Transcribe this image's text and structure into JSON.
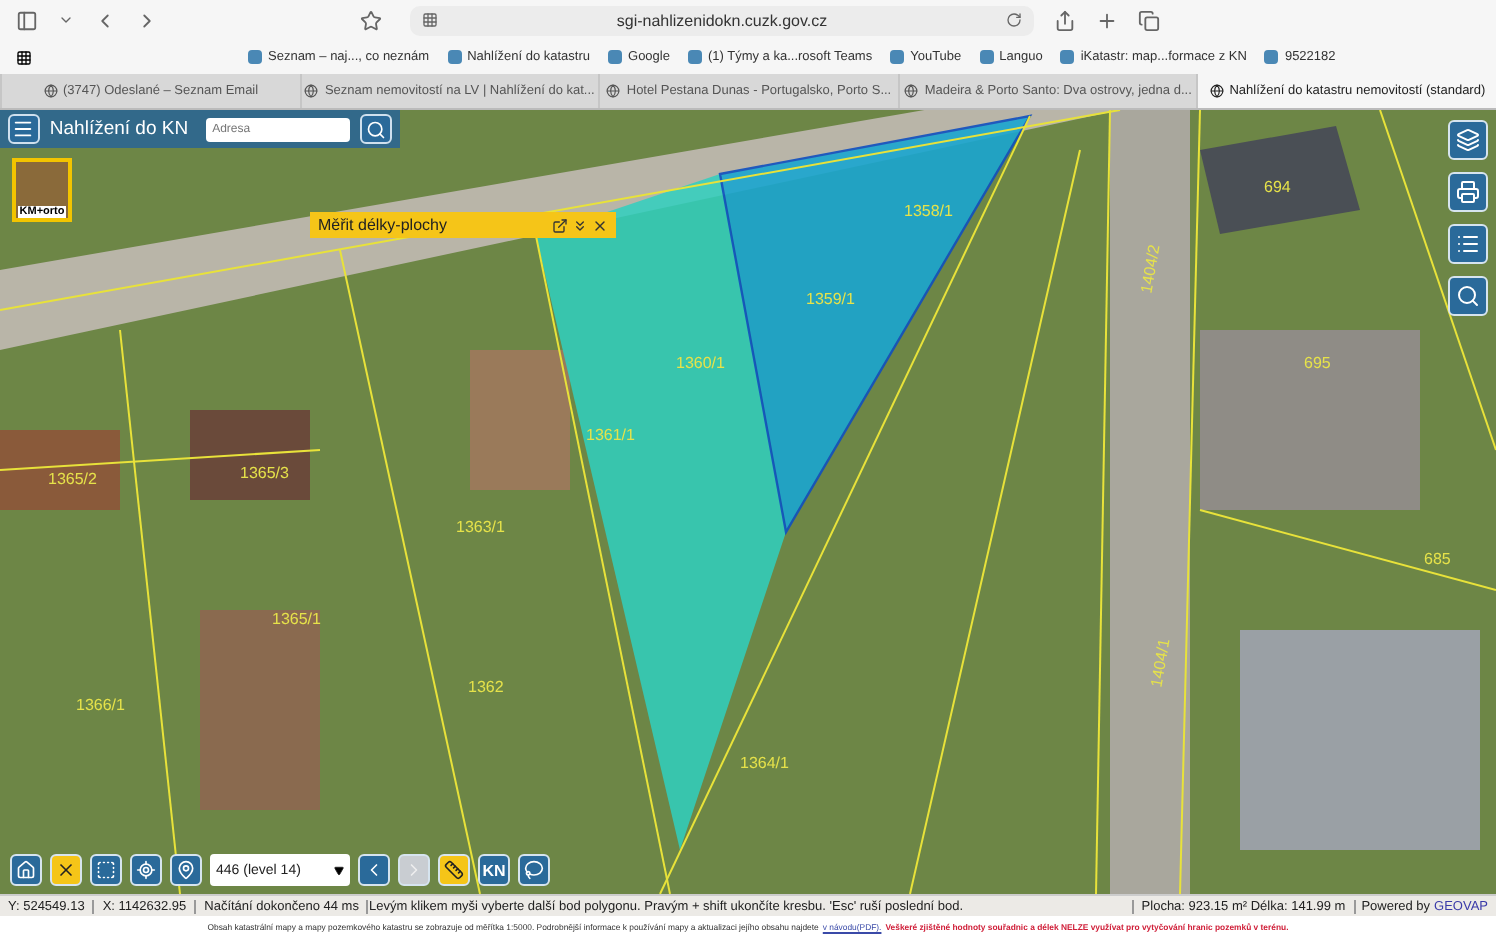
{
  "browser": {
    "url": "sgi-nahlizenidokn.cuzk.gov.cz",
    "bookmarks": [
      "Seznam – naj..., co neznám",
      "Nahlížení do katastru",
      "Google",
      "(1) Týmy a ka...rosoft Teams",
      "YouTube",
      "Languo",
      "iKatastr: map...formace z KN",
      "9522182"
    ],
    "tabs": [
      {
        "label": "(3747) Odeslané – Seznam Email",
        "selected": false
      },
      {
        "label": "Seznam nemovitostí na LV | Nahlížení do kat...",
        "selected": false
      },
      {
        "label": "Hotel Pestana Dunas - Portugalsko, Porto S...",
        "selected": false
      },
      {
        "label": "Madeira & Porto Santo: Dva ostrovy, jedna d...",
        "selected": false
      },
      {
        "label": "Nahlížení do katastru nemovitostí (standard)",
        "selected": true
      }
    ]
  },
  "map_header": {
    "title": "Nahlížení do KN",
    "search": {
      "placeholder": "Adresa"
    }
  },
  "basemap": {
    "label": "KM+orto"
  },
  "measure_panel": {
    "title": "Měřit délky-plochy"
  },
  "parcel_labels": [
    "1358/1",
    "1359/1",
    "1360/1",
    "1361/1",
    "1363/1",
    "1365/2",
    "1365/3",
    "1365/1",
    "1366/1",
    "1362",
    "1364/1",
    "1404/2",
    "1404/1",
    "694",
    "695",
    "685"
  ],
  "map_tools": [
    {
      "kind": "layers"
    },
    {
      "kind": "print"
    },
    {
      "kind": "legend"
    },
    {
      "kind": "search"
    }
  ],
  "toolbar": [
    {
      "kind": "home",
      "active": false
    },
    {
      "kind": "clear",
      "active": true
    },
    {
      "kind": "zoom-box",
      "active": false
    },
    {
      "kind": "locate",
      "active": false
    },
    {
      "kind": "pin",
      "active": false
    },
    {
      "kind": "select",
      "value": "446 (level 14)"
    },
    {
      "kind": "back",
      "disabled": false
    },
    {
      "kind": "forward",
      "disabled": true
    },
    {
      "kind": "measure",
      "active": true
    },
    {
      "kind": "text",
      "label": "KN",
      "active": false
    },
    {
      "kind": "lasso",
      "active": false
    }
  ],
  "status_bar": {
    "y": "Y: 524549.13",
    "x": "X: 1142632.95",
    "load": "Načítání dokončeno 44 ms",
    "hint": "Levým klikem myši vyberte další bod polygonu. Pravým + shift ukončíte kresbu. 'Esc' ruší poslední bod.",
    "measure": "Plocha: 923.15 m² Délka: 141.99 m",
    "powered": "Powered by",
    "brand": "GEOVAP"
  },
  "disclaimer": {
    "text": "Obsah katastrální mapy a mapy pozemkového katastru se zobrazuje od měřítka 1:5000. Podrobnější informace k používání mapy a aktualizaci jejího obsahu najdete",
    "link": "v návodu(PDF).",
    "warning": "Veškeré zjištěné hodnoty souřadnic a délek NELZE využívat pro vytyčování hranic pozemků v terénu."
  }
}
